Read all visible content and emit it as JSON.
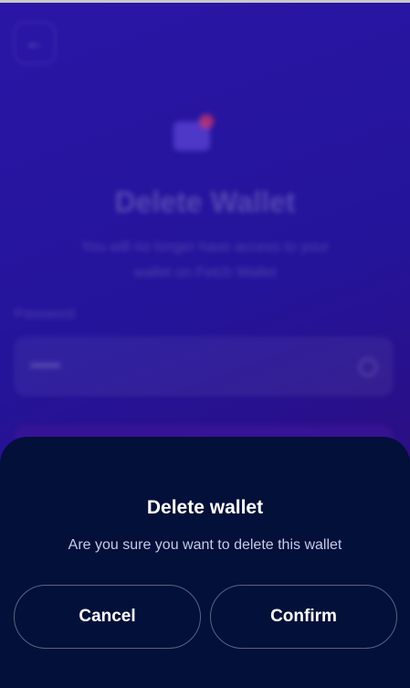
{
  "background": {
    "back_icon": "arrow-left-icon",
    "wallet_icon": "wallet-icon",
    "title": "Delete Wallet",
    "subtitle": "You will no longer have access to your wallet on Fetch Wallet",
    "password_label": "Password",
    "password_value": "•••••••",
    "eye_icon": "eye-icon"
  },
  "dialog": {
    "title": "Delete wallet",
    "message": "Are you sure you want to delete this wallet",
    "cancel_label": "Cancel",
    "confirm_label": "Confirm"
  },
  "colors": {
    "sheet_bg": "#02103a",
    "page_bg": "#24149a",
    "text": "#ffffff"
  }
}
